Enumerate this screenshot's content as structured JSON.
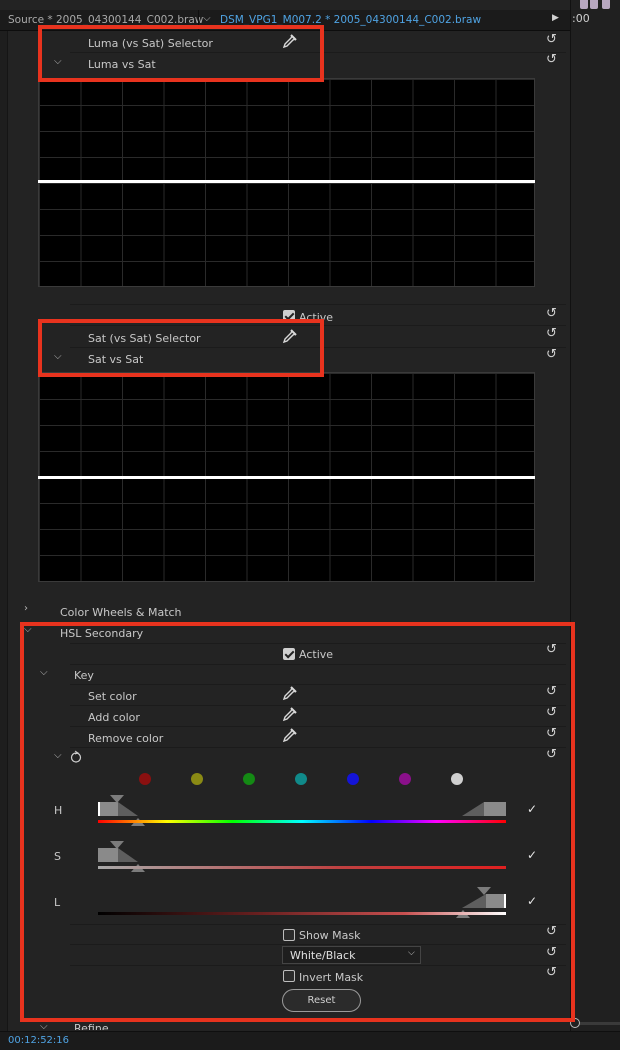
{
  "tabs": {
    "source": "Source * 2005_04300144_C002.braw",
    "clip": "DSM_VPG1_M007.2 * 2005_04300144_C002.braw",
    "chevron_icon": "chevron-down-icon",
    "play_icon": "play-icon"
  },
  "timeline_header": ":00",
  "luma_section": {
    "selector_label": "Luma (vs Sat) Selector",
    "curve_label": "Luma vs Sat",
    "active_label": "Active",
    "active_checked": true
  },
  "sat_section": {
    "selector_label": "Sat (vs Sat) Selector",
    "curve_label": "Sat vs Sat"
  },
  "color_wheels": {
    "label": "Color Wheels & Match"
  },
  "hsl": {
    "title": "HSL Secondary",
    "active_label": "Active",
    "active_checked": true,
    "key_label": "Key",
    "set_color": "Set color",
    "add_color": "Add color",
    "remove_color": "Remove color",
    "swatches": [
      "#8a1010",
      "#8a8a14",
      "#148a14",
      "#108a8a",
      "#1414d8",
      "#8a108a",
      "#d0d0d0"
    ],
    "channels": [
      {
        "letter": "H",
        "checked": true
      },
      {
        "letter": "S",
        "checked": true
      },
      {
        "letter": "L",
        "checked": true
      }
    ],
    "show_mask": "Show Mask",
    "show_mask_checked": false,
    "mask_mode": "White/Black",
    "invert_mask": "Invert Mask",
    "invert_mask_checked": false,
    "reset": "Reset"
  },
  "refine_label": "Refine",
  "timecode": "00:12:52:16",
  "colors": {
    "accent": "#4fa3e3",
    "highlight": "#e8331e"
  }
}
